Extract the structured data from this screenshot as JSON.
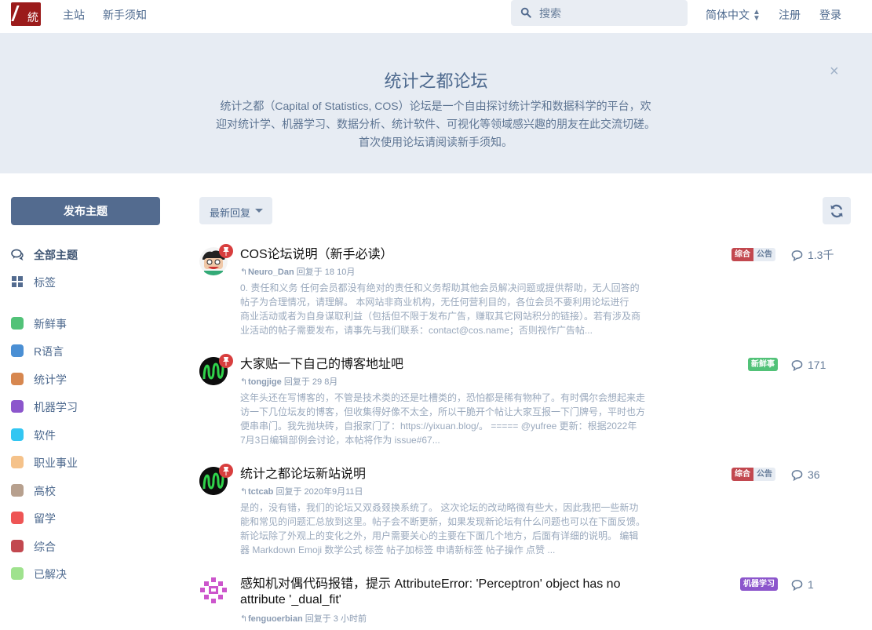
{
  "header": {
    "nav": [
      "主站",
      "新手须知"
    ],
    "search_placeholder": "搜索",
    "language": "简体中文",
    "register": "注册",
    "login": "登录",
    "logo_glyph": "統"
  },
  "hero": {
    "title": "统计之都论坛",
    "description_lines": [
      "统计之都（Capital of Statistics, COS）论坛是一个自由探讨统计学和数据科学的平台，欢",
      "迎对统计学、机器学习、数据分析、统计软件、可视化等领域感兴趣的朋友在此交流切磋。",
      "首次使用论坛请阅读新手须知。"
    ],
    "close": "×"
  },
  "sidebar": {
    "new_discussion": "发布主题",
    "nav": [
      {
        "label": "全部主题",
        "icon": "comments-icon"
      },
      {
        "label": "标签",
        "icon": "tags-grid-icon"
      }
    ],
    "tags": [
      {
        "label": "新鲜事",
        "color": "#52c278"
      },
      {
        "label": "R语言",
        "color": "#4a8fd4"
      },
      {
        "label": "统计学",
        "color": "#d7874f"
      },
      {
        "label": "机器学习",
        "color": "#8c56cc"
      },
      {
        "label": "软件",
        "color": "#33c6f2"
      },
      {
        "label": "职业事业",
        "color": "#f5c28a"
      },
      {
        "label": "高校",
        "color": "#b7a08e"
      },
      {
        "label": "留学",
        "color": "#ee5555"
      },
      {
        "label": "综合",
        "color": "#c2484f"
      },
      {
        "label": "已解决",
        "color": "#9fe28e"
      }
    ]
  },
  "toolbar": {
    "sort": "最新回复",
    "refresh_icon": "refresh-icon"
  },
  "discussions": [
    {
      "title": "COS论坛说明（新手必读）",
      "user": "Neuro_Dan",
      "reply_text": "回复于 18 10月",
      "excerpt_lines": [
        "0. 责任和义务 任何会员都没有绝对的责任和义务帮助其他会员解决问题或提供帮助，无人回答的",
        "帖子为合理情况，请理解。 本网站非商业机构，无任何营利目的，各位会员不要利用论坛进行",
        "商业活动或者为自身谋取利益（包括但不限于发布广告，赚取其它网站积分的链接）。若有涉及商",
        "业活动的帖子需要发布，请事先与我们联系：contact@cos.name；否则视作广告帖..."
      ],
      "tags": [
        {
          "label": "综合",
          "color": "#c2484f"
        },
        {
          "label": "公告",
          "color": "#e7ecf3"
        }
      ],
      "count": "1.3千",
      "pinned": true,
      "avatar": "face"
    },
    {
      "title": "大家贴一下自己的博客地址吧",
      "user": "tongjige",
      "reply_text": "回复于 29 8月",
      "excerpt_lines": [
        "这年头还在写博客的，不管是技术类的还是吐槽类的，恐怕都是稀有物种了。有时偶尔会想起来走",
        "访一下几位坛友的博客，但收集得好像不太全，所以干脆开个帖让大家互报一下门牌号，平时也方",
        "便串串门。我先抛块砖，自报家门了：https://yixuan.blog/。 ===== @yufree 更新：根据2022年",
        "7月3日编辑部例会讨论，本帖将作为 issue#67..."
      ],
      "tags": [
        {
          "label": "新鲜事",
          "color": "#52c278"
        }
      ],
      "count": "171",
      "pinned": true,
      "avatar": "wave"
    },
    {
      "title": "统计之都论坛新站说明",
      "user": "tctcab",
      "reply_text": "回复于 2020年9月11日",
      "excerpt_lines": [
        "是的，没有错，我们的论坛又双叒叕换系统了。 这次论坛的改动略微有些大，因此我把一些新功",
        "能和常见的问题汇总放到这里。帖子会不断更新，如果发现新论坛有什么问题也可以在下面反馈。",
        "新论坛除了外观上的变化之外，用户需要关心的主要在下面几个地方，后面有详细的说明。 编辑",
        "器 Markdown Emoji 数学公式 标签 帖子加标签 申请新标签 帖子操作 点赞 ..."
      ],
      "tags": [
        {
          "label": "综合",
          "color": "#c2484f"
        },
        {
          "label": "公告",
          "color": "#e7ecf3"
        }
      ],
      "count": "36",
      "pinned": true,
      "avatar": "wave"
    },
    {
      "title_lines": [
        "感知机对偶代码报错，提示 AttributeError: 'Perceptron' object has no",
        "attribute '_dual_fit'"
      ],
      "user": "fenguoerbian",
      "reply_text": "回复于 3 小时前",
      "tags": [
        {
          "label": "机器学习",
          "color": "#8c56cc"
        }
      ],
      "count": "1",
      "pinned": false,
      "avatar": "pattern"
    }
  ]
}
